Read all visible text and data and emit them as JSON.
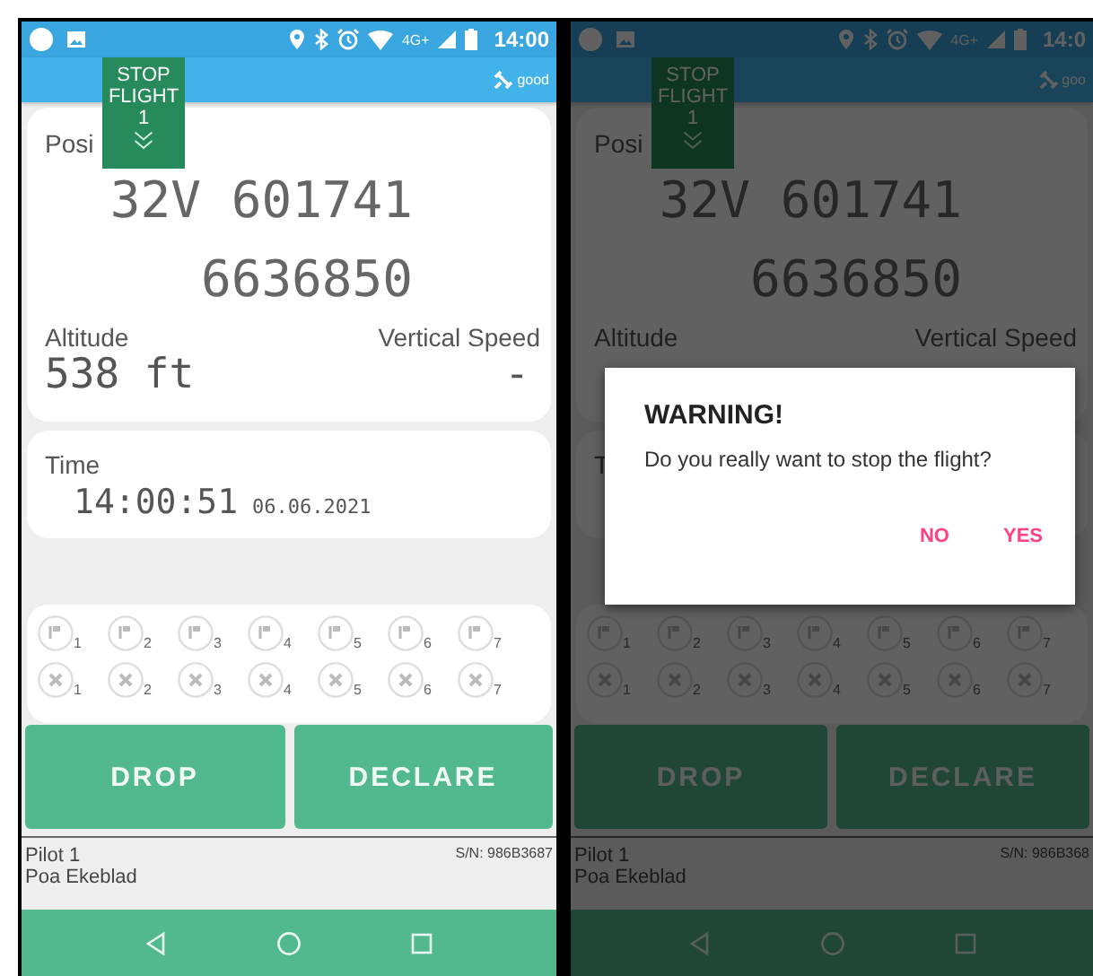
{
  "screens": [
    {
      "dimmed": false,
      "status_bar": {
        "network": "4G+",
        "time": "14:00"
      },
      "toolbar": {
        "gps_status": "good"
      },
      "stop_flight": {
        "label": "STOP FLIGHT 1"
      },
      "position": {
        "label": "Posi",
        "zone": "32V",
        "easting": "601741",
        "northing": "6636850"
      },
      "altitude": {
        "label": "Altitude",
        "value": "538 ft"
      },
      "vertical_speed": {
        "label": "Vertical Speed",
        "value": "-"
      },
      "time": {
        "label": "Time",
        "value": "14:00:51",
        "date": "06.06.2021"
      },
      "markers": [
        {
          "kind": "flag",
          "numbers": [
            "1",
            "2",
            "3",
            "4",
            "5",
            "6",
            "7"
          ]
        },
        {
          "kind": "cross",
          "numbers": [
            "1",
            "2",
            "3",
            "4",
            "5",
            "6",
            "7"
          ]
        }
      ],
      "buttons": [
        "DROP",
        "DECLARE"
      ],
      "footer": {
        "pilot": "Pilot 1",
        "name": "Poa Ekeblad",
        "serial": "S/N: 986B3687"
      }
    },
    {
      "dimmed": true,
      "status_bar": {
        "network": "4G+",
        "time": "14:0"
      },
      "toolbar": {
        "gps_status": "goo"
      },
      "stop_flight": {
        "label": "STOP FLIGHT 1"
      },
      "position": {
        "label": "Posi",
        "zone": "32V",
        "easting": "601741",
        "northing": "6636850"
      },
      "altitude": {
        "label": "Altitude"
      },
      "vertical_speed": {
        "label": "Vertical Speed"
      },
      "time": {
        "label": "T"
      },
      "markers": [
        {
          "kind": "flag",
          "numbers": [
            "1",
            "2",
            "3",
            "4",
            "5",
            "6",
            "7"
          ]
        },
        {
          "kind": "cross",
          "numbers": [
            "1",
            "2",
            "3",
            "4",
            "5",
            "6",
            "7"
          ]
        }
      ],
      "buttons": [
        "DROP",
        "DECLARE"
      ],
      "footer": {
        "pilot": "Pilot 1",
        "name": "Poa Ekeblad",
        "serial": "S/N: 986B368"
      },
      "dialog": {
        "title": "WARNING!",
        "message": "Do you really want to stop the flight?",
        "actions": [
          "NO",
          "YES"
        ]
      }
    }
  ]
}
